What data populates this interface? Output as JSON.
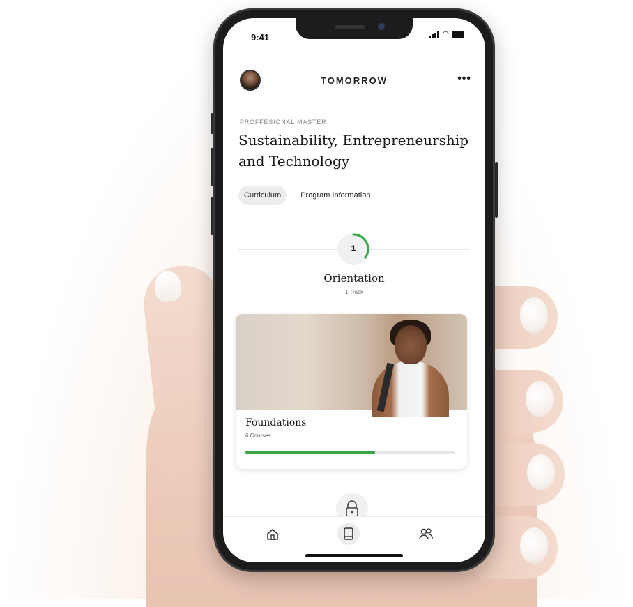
{
  "status_bar": {
    "time": "9:41"
  },
  "header": {
    "brand": "TOMORROW",
    "avatar_icon": "user-avatar",
    "more_icon": "more-icon",
    "more_label": "•••"
  },
  "program": {
    "eyebrow": "PROFFESIONAL MASTER",
    "title": "Sustainability, Entrepreneurship and Technology"
  },
  "tabs": [
    {
      "label": "Curriculum",
      "active": true
    },
    {
      "label": "Program Information",
      "active": false
    }
  ],
  "stage": {
    "number": "1",
    "name": "Orientation",
    "tracks": "1 Track",
    "ring_color": "#37a84a",
    "progress": 0.35
  },
  "card": {
    "title": "Foundations",
    "subtitle": "6 Courses",
    "progress": 0.62,
    "progress_color": "#37a84a"
  },
  "next_stage": {
    "locked_icon": "lock-icon"
  },
  "bottom_nav": [
    {
      "icon": "home-icon"
    },
    {
      "icon": "book-icon",
      "active": true
    },
    {
      "icon": "people-icon"
    }
  ]
}
